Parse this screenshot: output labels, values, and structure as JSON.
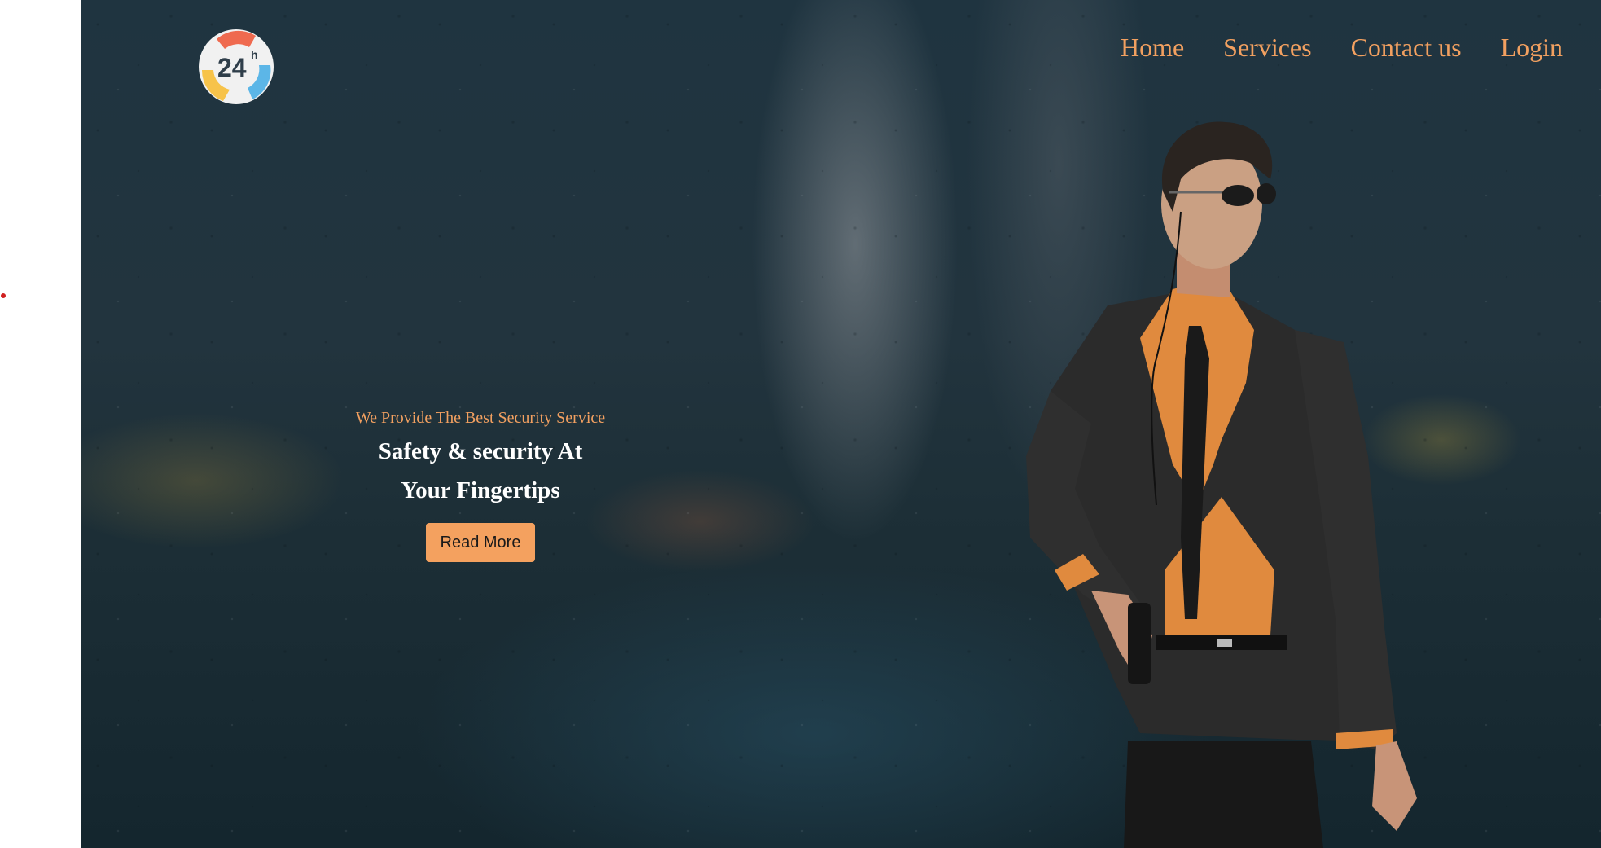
{
  "logo": {
    "text": "24",
    "superscript": "h"
  },
  "nav": {
    "items": [
      {
        "label": "Home"
      },
      {
        "label": "Services"
      },
      {
        "label": "Contact us"
      },
      {
        "label": "Login"
      }
    ]
  },
  "hero": {
    "tagline": "We Provide The Best Security Service",
    "headline_line1": "Safety & security At",
    "headline_line2": "Your Fingertips",
    "cta_label": "Read More"
  },
  "colors": {
    "accent": "#f2a060",
    "button": "#f4a15f",
    "headline": "#ffffff",
    "background": "#1f3440"
  },
  "images": {
    "hero_background": "rainy-city-street-photo",
    "hero_person": "security-guard-in-suit-photo"
  }
}
